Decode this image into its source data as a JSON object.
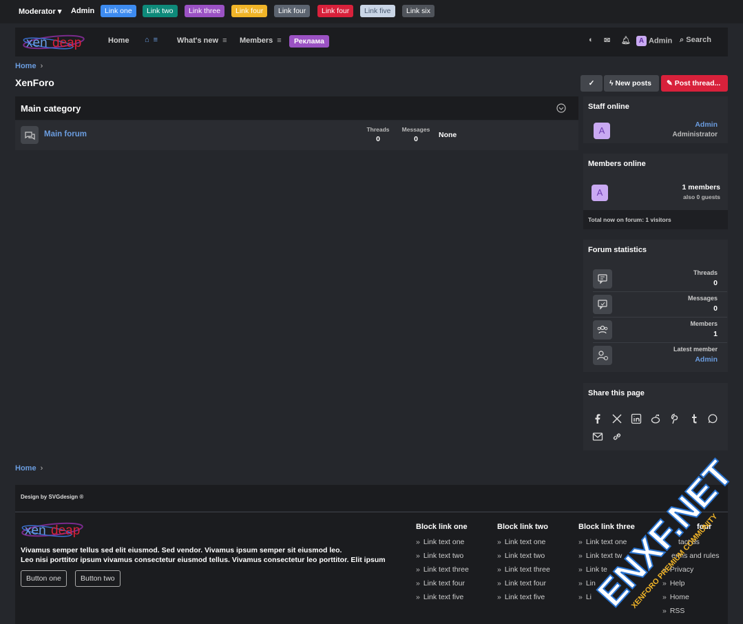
{
  "topbar": {
    "moderator": "Moderator ▾",
    "admin": "Admin",
    "links": [
      {
        "label": "Link one",
        "color": "#3d8bf0"
      },
      {
        "label": "Link two",
        "color": "#0e8a7a"
      },
      {
        "label": "Link three",
        "color": "#9b52c4"
      },
      {
        "label": "Link four",
        "color": "#f0b428"
      },
      {
        "label": "Link four",
        "color": "#5c6470"
      },
      {
        "label": "Link four",
        "color": "#d8213b"
      },
      {
        "label": "Link five",
        "color": "#c9d5e6"
      },
      {
        "label": "Link six",
        "color": "#4f535a"
      }
    ]
  },
  "nav": {
    "logo_text_a": "xen",
    "logo_text_b": "deap",
    "home": "Home",
    "whats_new": "What's new",
    "members": "Members",
    "ad": "Реклама",
    "user": "Admin",
    "search": "Search"
  },
  "breadcrumb": {
    "home": "Home"
  },
  "page": {
    "title": "XenForo"
  },
  "actions": {
    "new_posts": "New posts",
    "post_thread": "Post thread..."
  },
  "category": {
    "title": "Main category",
    "forum": {
      "name": "Main forum",
      "threads_label": "Threads",
      "threads": "0",
      "messages_label": "Messages",
      "messages": "0",
      "last_post": "None"
    }
  },
  "sidebar": {
    "staff": {
      "title": "Staff online",
      "avatar": "A",
      "name": "Admin",
      "role": "Administrator"
    },
    "members_online": {
      "title": "Members online",
      "avatar": "A",
      "count": "1 members",
      "guests": "also 0 guests",
      "total": "Total now on forum: 1 visitors"
    },
    "stats": {
      "title": "Forum statistics",
      "threads_label": "Threads",
      "threads": "0",
      "messages_label": "Messages",
      "messages": "0",
      "members_label": "Members",
      "members": "1",
      "latest_label": "Latest member",
      "latest": "Admin"
    },
    "share": {
      "title": "Share this page"
    }
  },
  "footer": {
    "breadcrumb": "Home",
    "design": "Design by SVGdesign ®",
    "text1": "Vivamus semper tellus sed elit eiusmod. Sed vendor. Vivamus ipsum semper sit eiusmod leo.",
    "text2": "Leo nisi porttitor ipsum vivamus consectetur eiusmod tellus. Vivamus consectetur leo porttitor. Elit ipsum",
    "button_one": "Button one",
    "button_two": "Button two",
    "col1": {
      "title": "Block link one",
      "links": [
        "Link text one",
        "Link text two",
        "Link text three",
        "Link text four",
        "Link text five"
      ]
    },
    "col2": {
      "title": "Block link two",
      "links": [
        "Link text one",
        "Link text two",
        "Link text three",
        "Link text four",
        "Link text five"
      ]
    },
    "col3": {
      "title": "Block link three",
      "links": [
        "Link text one",
        "Link text tw",
        "Link te",
        "Lin",
        "Li"
      ]
    },
    "col4": {
      "title": "four",
      "links": [
        "tact us",
        "erms and rules",
        "Privacy",
        "Help",
        "Home",
        "RSS"
      ]
    }
  },
  "watermark": {
    "main": "ENXF.NET",
    "sub": "XENFORO PREMIUM COMMUNITY"
  }
}
